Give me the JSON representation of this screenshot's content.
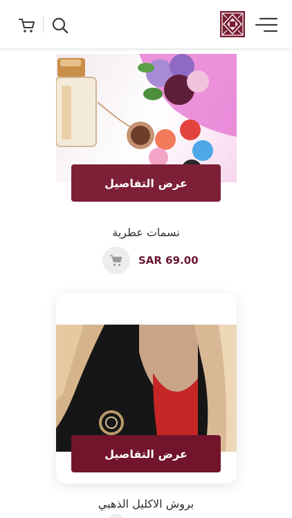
{
  "header": {
    "icons": [
      "cart-icon",
      "search-icon",
      "logo",
      "menu-icon"
    ]
  },
  "products": [
    {
      "details_label": "عرض التفاصيل",
      "name": "نسمات عطرية",
      "price": "SAR 69.00"
    },
    {
      "details_label": "عرض التفاصيل",
      "name": "بروش الاكليل الذهبي"
    }
  ],
  "colors": {
    "accent": "#7d2037",
    "price": "#6a1730",
    "icon_bg": "#ededed"
  }
}
